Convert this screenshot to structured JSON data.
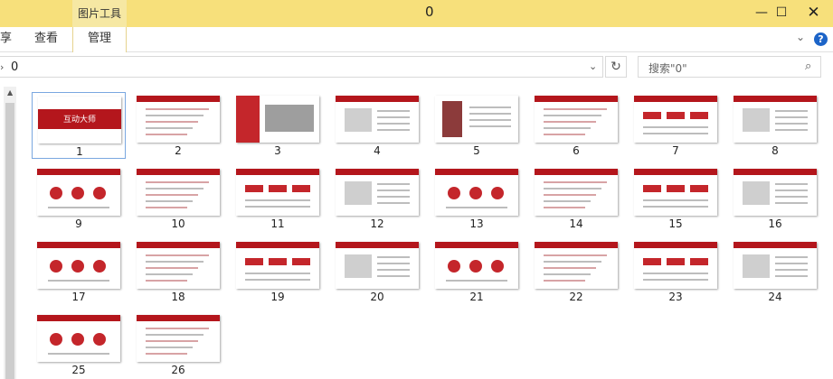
{
  "window": {
    "context_tab": "图片工具",
    "title": "0",
    "min_glyph": "—",
    "max_glyph": "☐",
    "close_glyph": "✕"
  },
  "ribbon": {
    "tabs": [
      {
        "label": "享"
      },
      {
        "label": "查看"
      },
      {
        "label": "管理"
      }
    ],
    "chevron": "⌄",
    "help": "?"
  },
  "address": {
    "separator": "›",
    "path": "0",
    "dropdown": "⌄",
    "refresh": "↻"
  },
  "search": {
    "placeholder": "搜索\"0\"",
    "icon": "⌕"
  },
  "files": [
    {
      "label": "1",
      "text": "互动大师"
    },
    {
      "label": "2"
    },
    {
      "label": "3"
    },
    {
      "label": "4"
    },
    {
      "label": "5"
    },
    {
      "label": "6"
    },
    {
      "label": "7"
    },
    {
      "label": "8"
    },
    {
      "label": "9"
    },
    {
      "label": "10"
    },
    {
      "label": "11"
    },
    {
      "label": "12"
    },
    {
      "label": "13"
    },
    {
      "label": "14"
    },
    {
      "label": "15"
    },
    {
      "label": "16"
    },
    {
      "label": "17"
    },
    {
      "label": "18"
    },
    {
      "label": "19"
    },
    {
      "label": "20"
    },
    {
      "label": "21"
    },
    {
      "label": "22"
    },
    {
      "label": "23"
    },
    {
      "label": "24"
    },
    {
      "label": "25"
    },
    {
      "label": "26"
    }
  ],
  "selected_index": 0,
  "colors": {
    "accent_red": "#b4161c",
    "title_bar": "#f7e07b",
    "selection": "#7aa7e0"
  }
}
